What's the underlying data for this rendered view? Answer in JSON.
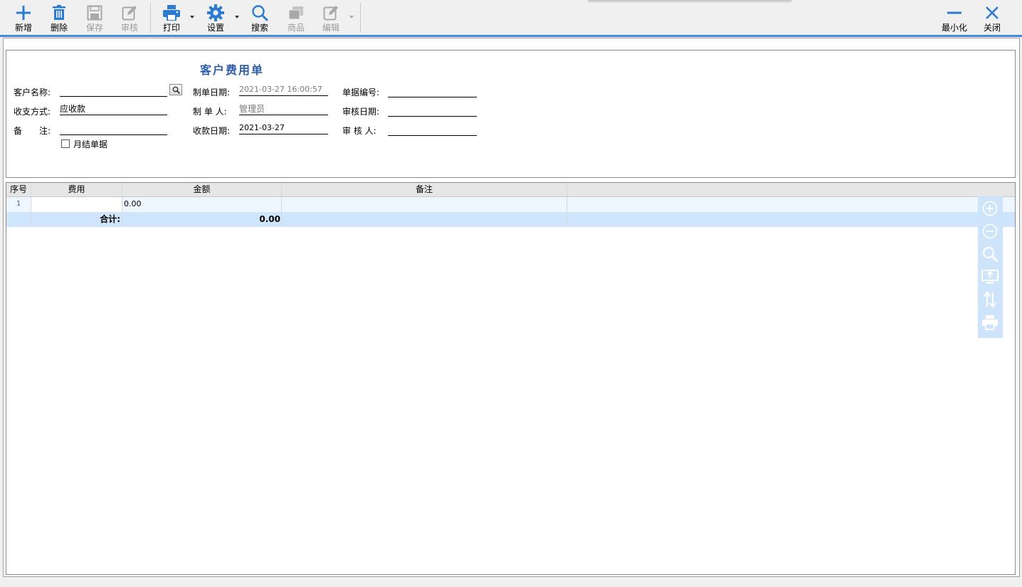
{
  "toolbar": {
    "new": "新增",
    "delete": "删除",
    "save": "保存",
    "audit": "审核",
    "print": "打印",
    "settings": "设置",
    "search": "搜索",
    "goods": "商品",
    "edit": "编辑",
    "minimize": "最小化",
    "close": "关闭"
  },
  "form": {
    "title": "客户费用单",
    "customer_name_label": "客户名称:",
    "customer_name_value": "",
    "payment_type_label": "收支方式:",
    "payment_type_value": "应收款",
    "remark_label_1": "备",
    "remark_label_2": "注:",
    "remark_value": "",
    "create_date_label": "制单日期:",
    "create_date_value": "2021-03-27 16:00:57",
    "creator_label": "制 单 人:",
    "creator_value": "管理员",
    "collect_date_label": "收款日期:",
    "collect_date_value": "2021-03-27",
    "doc_no_label": "单据编号:",
    "doc_no_value": "",
    "audit_date_label": "审核日期:",
    "audit_date_value": "",
    "auditor_label": "审 核 人:",
    "auditor_value": "",
    "monthly_checkbox_label": "月结单据",
    "monthly_checked": false
  },
  "grid": {
    "headers": {
      "seq": "序号",
      "fee": "费用",
      "amount": "金额",
      "note": "备注"
    },
    "rows": [
      {
        "seq": "1",
        "fee": "",
        "amount": "0.00",
        "note": ""
      }
    ],
    "total": {
      "label": "合计:",
      "amount": "0.00"
    }
  },
  "side_tools": [
    "zoom-in-icon",
    "zoom-out-icon",
    "magnifier-icon",
    "screen-share-icon",
    "sort-arrows-icon",
    "printer-icon"
  ],
  "colors": {
    "accent": "#3d8bd9",
    "toolbar_icon": "#2b7bd0",
    "disabled_icon": "#a8a8a8",
    "title": "#2f5fa8",
    "total_row": "#cfe5fb"
  }
}
